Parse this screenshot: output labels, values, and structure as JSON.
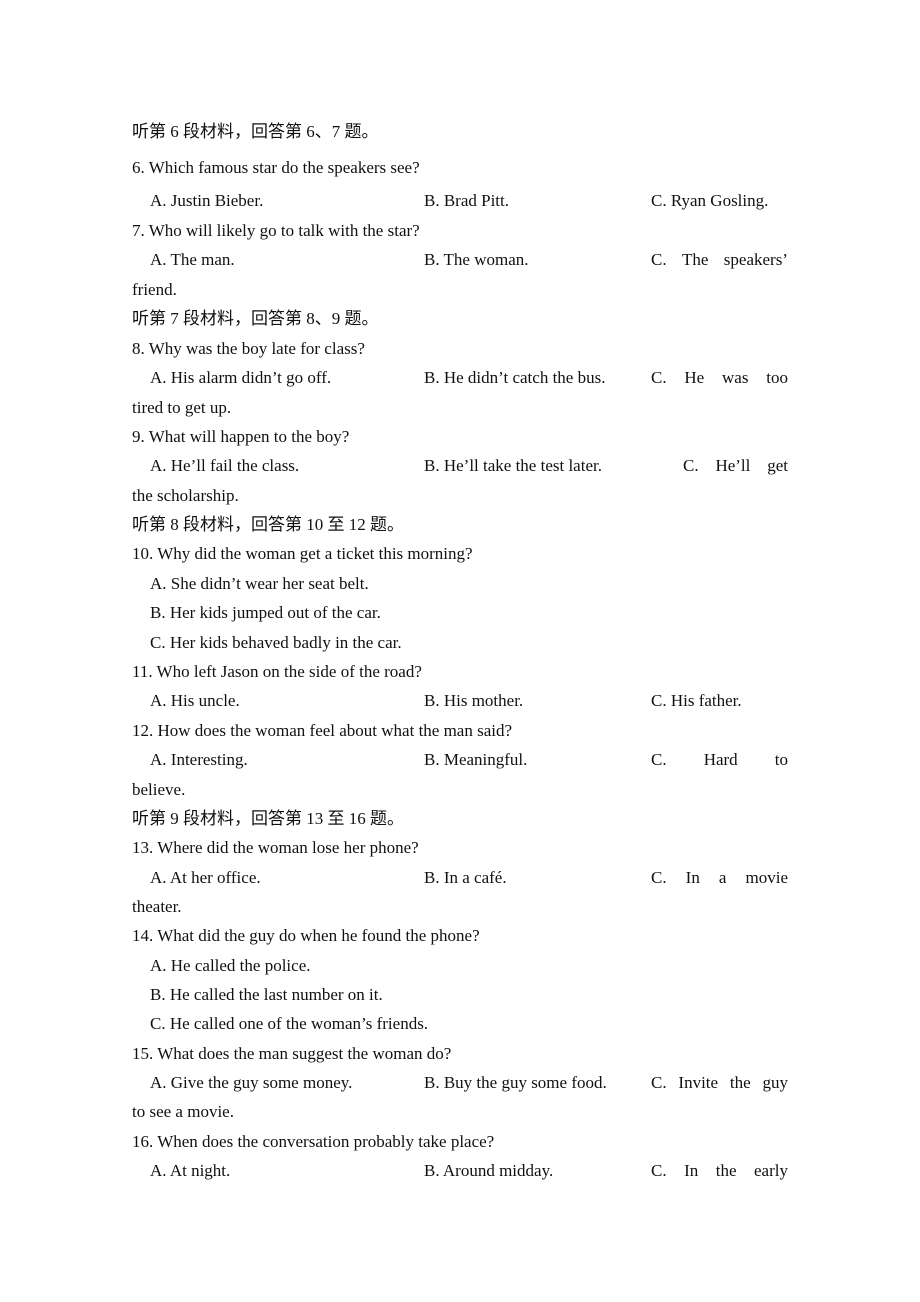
{
  "sections": [
    {
      "heading": "听第 6 段材料，回答第 6、7 题。",
      "questions": [
        {
          "q": "6. Which famous star do the speakers see?",
          "A": "A. Justin Bieber.",
          "B": "B. Brad Pitt.",
          "C": "C. Ryan Gosling.",
          "C_cont": ""
        },
        {
          "q": "7. Who will likely go to talk with the star?",
          "A": "A. The man.",
          "B": "B. The woman.",
          "C_words": [
            "C.",
            "The",
            "speakers’"
          ],
          "C_cont": "friend."
        }
      ]
    },
    {
      "heading": "听第 7 段材料，回答第 8、9 题。",
      "questions": [
        {
          "q": "8. Why was the boy late for class?",
          "A": "A. His alarm didn’t go off.",
          "B": "B. He didn’t catch the bus.",
          "C_words": [
            "C.",
            "He",
            "was",
            "too"
          ],
          "C_cont": "tired to get up."
        },
        {
          "q": "9. What will happen to the boy?",
          "A": "A. He’ll fail the class.",
          "B": "B. He’ll take the test later.",
          "C_words": [
            "C.",
            "He’ll",
            "get"
          ],
          "C_cont": "the scholarship."
        }
      ]
    },
    {
      "heading": "听第 8 段材料，回答第 10 至 12 题。",
      "questions": [
        {
          "q": "10. Why did the woman get a ticket this morning?",
          "A": "A. She didn’t wear her seat belt.",
          "B": "B. Her kids jumped out of the car.",
          "C": "C. Her kids behaved badly in the car."
        },
        {
          "q": "11. Who left Jason on the side of the road?",
          "A": "A. His uncle.",
          "B": "B. His mother.",
          "C": "C. His father."
        },
        {
          "q": "12. How does the woman feel about what the man said?",
          "A": "A. Interesting.",
          "B": "B. Meaningful.",
          "C_words": [
            "C.",
            "Hard",
            "to"
          ],
          "C_cont": "believe."
        }
      ]
    },
    {
      "heading": "听第 9 段材料，回答第 13 至 16 题。",
      "questions": [
        {
          "q": "13. Where did the woman lose her phone?",
          "A": "A. At her office.",
          "B": "B. In a café.",
          "C_words": [
            "C.",
            "In",
            "a",
            "movie"
          ],
          "C_cont": "theater."
        },
        {
          "q": "14. What did the guy do when he found the phone?",
          "A": "A. He called the police.",
          "B": "B. He called the last number on it.",
          "C": "C. He called one of the woman’s friends."
        },
        {
          "q": "15. What does the man suggest the woman do?",
          "A": "A. Give the guy some money.",
          "B": "B. Buy the guy some food.",
          "C_words": [
            "C.",
            "Invite",
            "the",
            "guy"
          ],
          "C_cont": "to see a movie."
        },
        {
          "q": "16. When does the conversation probably take place?",
          "A": "A. At night.",
          "B": "B. Around midday.",
          "C_words": [
            "C.",
            "In",
            "the",
            "early"
          ],
          "C_cont": ""
        }
      ]
    }
  ]
}
